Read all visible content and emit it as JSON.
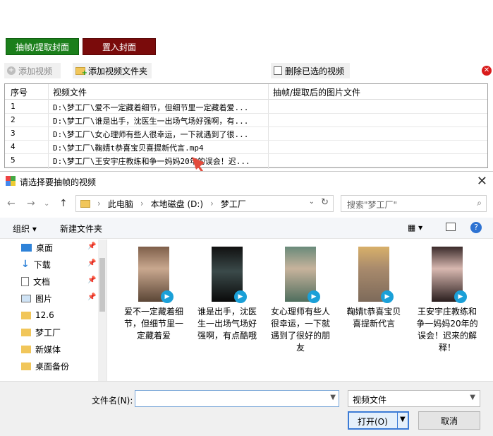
{
  "app": {
    "extract_button": "抽帧/提取封面",
    "insert_cover_button": "置入封面",
    "add_video": "添加视频",
    "add_folder": "添加视频文件夹",
    "delete_selected": "删除已选的视频",
    "columns": [
      "序号",
      "视频文件",
      "抽帧/提取后的图片文件"
    ],
    "rows": [
      {
        "idx": "1",
        "file": "D:\\梦工厂\\爱不一定藏着细节，但细节里一定藏着爱..."
      },
      {
        "idx": "2",
        "file": "D:\\梦工厂\\谁是出手，沈医生一出场气场好强啊，有..."
      },
      {
        "idx": "3",
        "file": "D:\\梦工厂\\女心理师有些人很幸运，一下就遇到了很..."
      },
      {
        "idx": "4",
        "file": "D:\\梦工厂\\鞠婧t恭喜宝贝喜提新代言.mp4"
      },
      {
        "idx": "5",
        "file": "D:\\梦工厂\\王安宇庄教练和争一妈妈20年的误会！迟..."
      }
    ]
  },
  "dialog": {
    "title": "请选择要抽帧的视频",
    "breadcrumb": [
      "此电脑",
      "本地磁盘 (D:)",
      "梦工厂"
    ],
    "search_placeholder": "搜索\"梦工厂\"",
    "organize": "组织 ▾",
    "new_folder": "新建文件夹",
    "sidebar": [
      "桌面",
      "下载",
      "文档",
      "图片",
      "12.6",
      "梦工厂",
      "新媒体",
      "桌面备份"
    ],
    "files": [
      "爱不一定藏着细节，但细节里一定藏着爱",
      "谁是出手，沈医生一出场气场好强啊，有点酷哦",
      "女心理师有些人很幸运，一下就遇到了很好的朋友",
      "鞠婧t恭喜宝贝喜提新代言",
      "王安宇庄教练和争一妈妈20年的误会！迟来的解释！"
    ],
    "filename_label": "文件名(N):",
    "filename_value": "",
    "filetype": "视频文件",
    "open": "打开(O)",
    "cancel": "取消"
  },
  "colors": {
    "green": "#1b7f1b",
    "red": "#7a0b0b",
    "arrow": "#e34b3c",
    "accent": "#3b7bd6"
  }
}
